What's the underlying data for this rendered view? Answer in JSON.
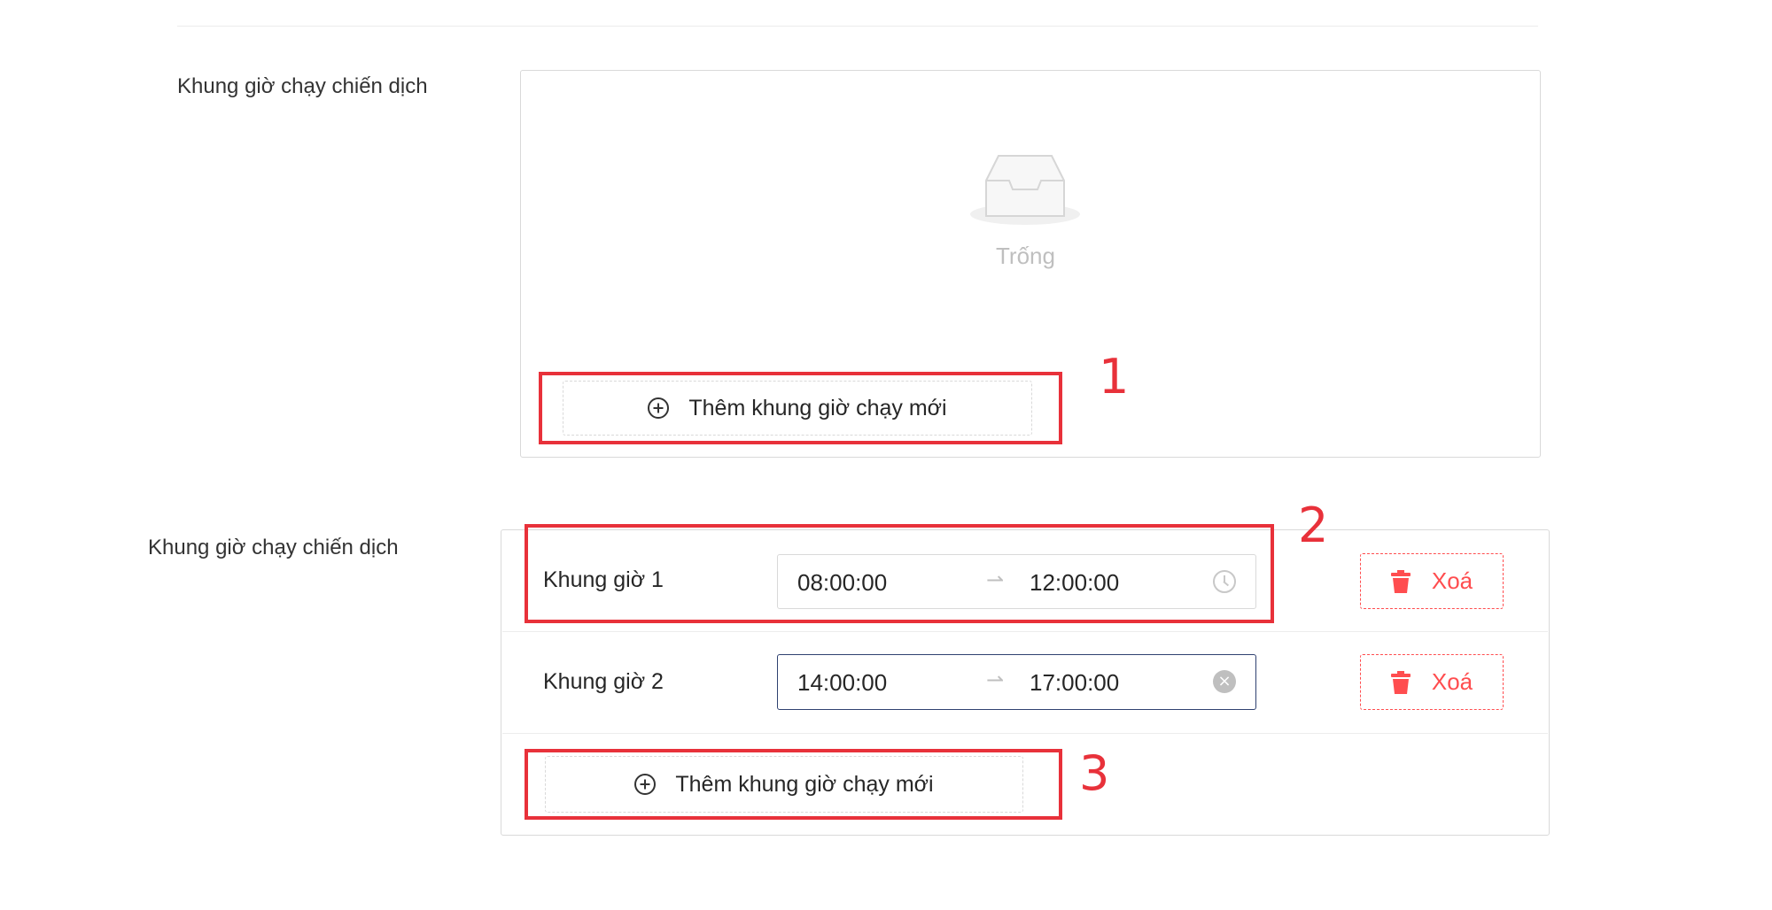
{
  "section1": {
    "label": "Khung giờ chạy chiến dịch",
    "empty_text": "Trống",
    "add_button_label": "Thêm khung giờ chạy mới",
    "marker": "1"
  },
  "section2": {
    "label": "Khung giờ chạy chiến dịch",
    "slots": [
      {
        "label": "Khung giờ 1",
        "start": "08:00:00",
        "end": "12:00:00",
        "delete_label": "Xoá"
      },
      {
        "label": "Khung giờ 2",
        "start": "14:00:00",
        "end": "17:00:00",
        "delete_label": "Xoá"
      }
    ],
    "add_button_label": "Thêm khung giờ chạy mới",
    "marker_slot": "2",
    "marker_add": "3"
  },
  "colors": {
    "highlight": "#e8313a",
    "danger": "#ff4d4f",
    "active_border": "#2f4170",
    "empty_text": "#bfbfbf"
  },
  "icons": [
    "inbox-empty-icon",
    "plus-circle-icon",
    "clock-icon",
    "arrow-right-icon",
    "clear-circle-icon",
    "trash-icon"
  ]
}
